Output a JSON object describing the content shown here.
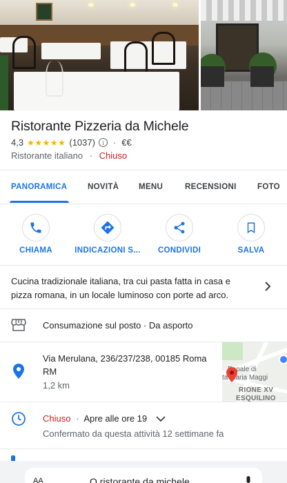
{
  "place": {
    "name": "Ristorante Pizzeria da Michele",
    "rating": "4,3",
    "stars": "★★★★★",
    "reviews": "(1037)",
    "info_glyph": "i",
    "price": "€€",
    "category": "Ristorante italiano",
    "status": "Chiuso",
    "separator": "·"
  },
  "tabs": [
    {
      "label": "PANORAMICA"
    },
    {
      "label": "NOVITÀ"
    },
    {
      "label": "MENU"
    },
    {
      "label": "RECENSIONI"
    },
    {
      "label": "FOTO"
    }
  ],
  "actions": [
    {
      "label": "CHIAMA",
      "icon": "phone-icon"
    },
    {
      "label": "INDICAZIONI S...",
      "icon": "directions-icon"
    },
    {
      "label": "CONDIVIDI",
      "icon": "share-icon"
    },
    {
      "label": "SALVA",
      "icon": "bookmark-icon"
    }
  ],
  "description": "Cucina tradizionale italiana, tra cui pasta fatta in casa e pizza romana, in un locale luminoso con porte ad arco.",
  "service": {
    "text": "Consumazione sul posto · Da asporto",
    "icon": "storefront-icon"
  },
  "address": {
    "line1": "Via Merulana, 236/237/238, 00185 Roma",
    "line2": "RM",
    "distance": "1,2 km",
    "icon": "location-pin-icon"
  },
  "map": {
    "label1": "Papale di",
    "label2": "ta Maria Maggi",
    "district1": "RIONE XV",
    "district2": "ESQUILINO"
  },
  "hours": {
    "status": "Chiuso",
    "separator": "·",
    "opens": "Apre alle ore 19",
    "confirmed": "Confermato da questa attività 12 settimane fa",
    "icon": "clock-icon"
  },
  "search_bar": {
    "aa": "AA",
    "query": "Q ristorante da michele"
  },
  "colors": {
    "accent": "#1a73e8",
    "closed": "#c5221f",
    "star": "#f4b400",
    "pin": "#1a73e8"
  }
}
